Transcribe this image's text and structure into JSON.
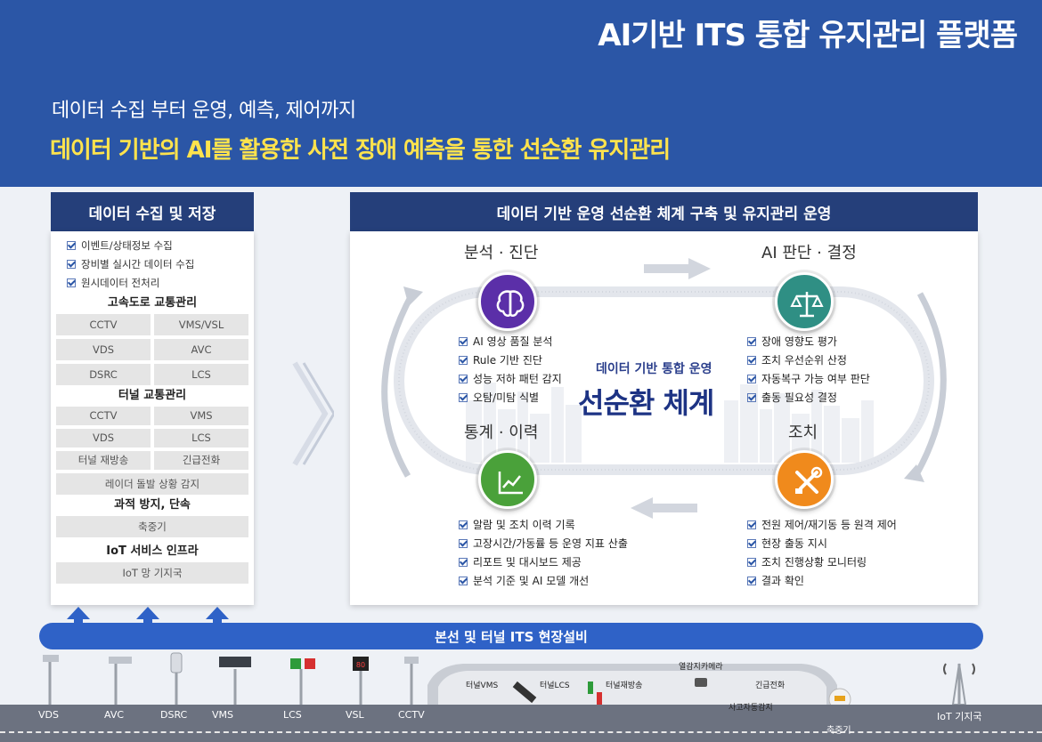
{
  "header": {
    "title": "AI기반 ITS 통합 유지관리 플랫폼",
    "subtitle": "데이터 수집 부터 운영, 예측, 제어까지",
    "headline": "데이터 기반의  AI를 활용한 사전 장애 예측을 통한 선순환 유지관리"
  },
  "left": {
    "header": "데이터 수집 및 저장",
    "checks": [
      "이벤트/상태정보 수집",
      "장비별 실시간 데이터 수집",
      "원시데이터 전처리"
    ],
    "highway": {
      "title": "고속도로 교통관리",
      "items": [
        "CCTV",
        "VMS/VSL",
        "VDS",
        "AVC",
        "DSRC",
        "LCS"
      ]
    },
    "tunnel": {
      "title": "터널 교통관리",
      "items": [
        "CCTV",
        "VMS",
        "VDS",
        "LCS",
        "터널 재방송",
        "긴급전화"
      ],
      "wide": "레이더 돌발 상황 감지"
    },
    "overload": {
      "title": "과적 방지, 단속",
      "items": [
        "축중기"
      ]
    },
    "iot": {
      "title": "IoT 서비스 인프라",
      "items": [
        "IoT 망 기지국"
      ]
    }
  },
  "right": {
    "header": "데이터 기반 운영 선순환 체계 구축 및 유지관리 운영",
    "center_sub": "데이터 기반 통합 운영",
    "center_main": "선순환 체계",
    "analysis": {
      "title": "분석 · 진단",
      "color": "#5b2fa8",
      "items": [
        "AI 영상 품질 분석",
        "Rule 기반 진단",
        "성능 저하 패턴 감지",
        "오탐/미탐 식별"
      ]
    },
    "decision": {
      "title": "AI 판단 · 결정",
      "color": "#2f8f84",
      "items": [
        "장애 영향도 평가",
        "조치 우선순위 산정",
        "자동복구 가능 여부 판단",
        "출동 필요성 결정"
      ]
    },
    "stats": {
      "title": "통계 · 이력",
      "color": "#4aa13a",
      "items": [
        "알람 및 조치 이력 기록",
        "고장시간/가동률 등 운영 지표 산출",
        "리포트 및 대시보드 제공",
        "분석 기준 및 AI 모델 개선"
      ]
    },
    "action": {
      "title": "조치",
      "color": "#f08a1c",
      "items": [
        "전원 제어/재기동 등 원격 제어",
        "현장 출동 지시",
        "조치 진행상황 모니터링",
        "결과 확인"
      ]
    }
  },
  "field": {
    "bar_label": "본선 및 터널 ITS 현장설비",
    "devices": [
      "VDS",
      "AVC",
      "DSRC",
      "VMS",
      "LCS",
      "VSL",
      "CCTV"
    ],
    "tunnel_devices": [
      "터널VMS",
      "터널LCS",
      "터널재방송",
      "열감지카메라",
      "긴급전화",
      "사고자동감지"
    ],
    "axle": "축중기",
    "iot": "IoT 기지국",
    "vsl_value": "80"
  }
}
